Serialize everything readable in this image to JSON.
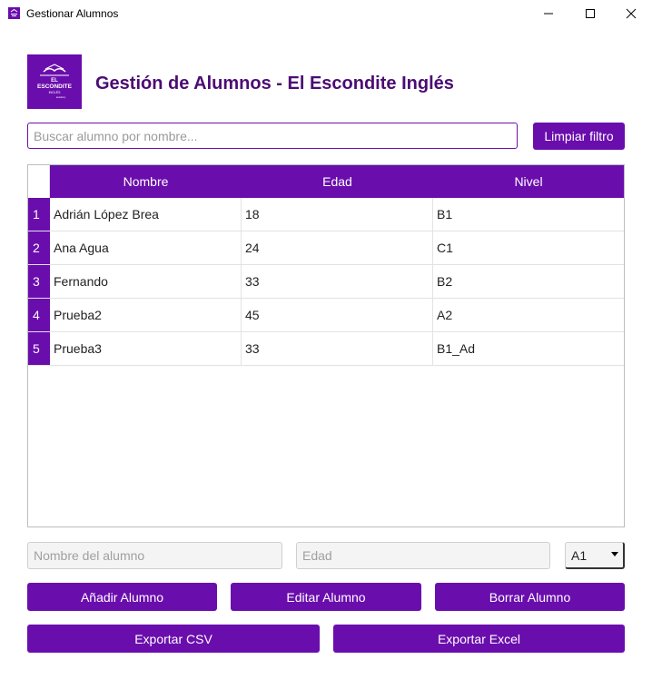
{
  "window": {
    "title": "Gestionar Alumnos",
    "controls": [
      "minimize-icon",
      "maximize-icon",
      "close-icon"
    ]
  },
  "header": {
    "logo_text": "EL ESCONDITE INGLÉS",
    "title": "Gestión de Alumnos - El Escondite Inglés"
  },
  "search": {
    "placeholder": "Buscar alumno por nombre...",
    "value": "",
    "clear_label": "Limpiar filtro"
  },
  "table": {
    "columns": [
      "Nombre",
      "Edad",
      "Nivel"
    ],
    "rows": [
      {
        "index": "1",
        "name": "Adrián López Brea",
        "age": "18",
        "level": "B1"
      },
      {
        "index": "2",
        "name": "Ana Agua",
        "age": "24",
        "level": "C1"
      },
      {
        "index": "3",
        "name": "Fernando",
        "age": "33",
        "level": "B2"
      },
      {
        "index": "4",
        "name": "Prueba2",
        "age": "45",
        "level": "A2"
      },
      {
        "index": "5",
        "name": "Prueba3",
        "age": "33",
        "level": "B1_Ad"
      }
    ]
  },
  "form": {
    "name_placeholder": "Nombre del alumno",
    "age_placeholder": "Edad",
    "level_selected": "A1"
  },
  "actions": {
    "add_label": "Añadir Alumno",
    "edit_label": "Editar Alumno",
    "delete_label": "Borrar Alumno",
    "export_csv_label": "Exportar CSV",
    "export_excel_label": "Exportar Excel"
  },
  "colors": {
    "accent": "#6a0dad",
    "title_text": "#4b0c73"
  }
}
